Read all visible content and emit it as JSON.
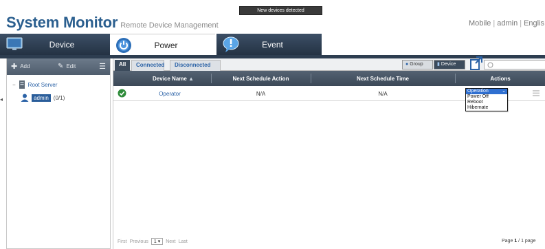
{
  "header": {
    "title": "System Monitor",
    "subtitle": "Remote Device Management",
    "notice": "New devices detected",
    "links": [
      "Mobile",
      "admin",
      "Englis"
    ]
  },
  "modules": {
    "device": "Device",
    "power": "Power",
    "event": "Event"
  },
  "sidebar": {
    "add_label": "Add",
    "edit_label": "Edit",
    "root": "Root Server",
    "user": "admin",
    "user_count": "(0/1)"
  },
  "filters": {
    "all": "All",
    "connected": "Connected",
    "disconnected": "Disconnected"
  },
  "view": {
    "group": "Group",
    "device": "Device"
  },
  "table": {
    "columns": [
      "Device Name",
      "Next Schedule Action",
      "Next Schedule Time",
      "Actions"
    ],
    "rows": [
      {
        "name": "Operator",
        "next_action": "N/A",
        "next_time": "N/A",
        "action_value": "Operation"
      }
    ]
  },
  "action_menu": [
    "Operation",
    "Power Off",
    "Reboot",
    "Hibernate"
  ],
  "pager": {
    "first": "First",
    "previous": "Previous",
    "page": "1",
    "next": "Next",
    "last": "Last",
    "page_prefix": "Page",
    "current": "1",
    "total": "1 page"
  },
  "colors": {
    "title": "#2b5f8f",
    "nav_dark": "#2d3d50",
    "link": "#2b62a6",
    "selected": "#2f6fd0",
    "status_ok": "#2e8b3a"
  },
  "icons": {
    "device": "monitor-icon",
    "power": "power-icon",
    "event": "speech-bubble-icon",
    "add": "plus-icon",
    "edit": "pencil-icon",
    "list": "list-icon",
    "server": "server-icon",
    "user": "user-icon",
    "status": "check-circle-icon",
    "export": "export-icon",
    "search": "search-icon"
  }
}
